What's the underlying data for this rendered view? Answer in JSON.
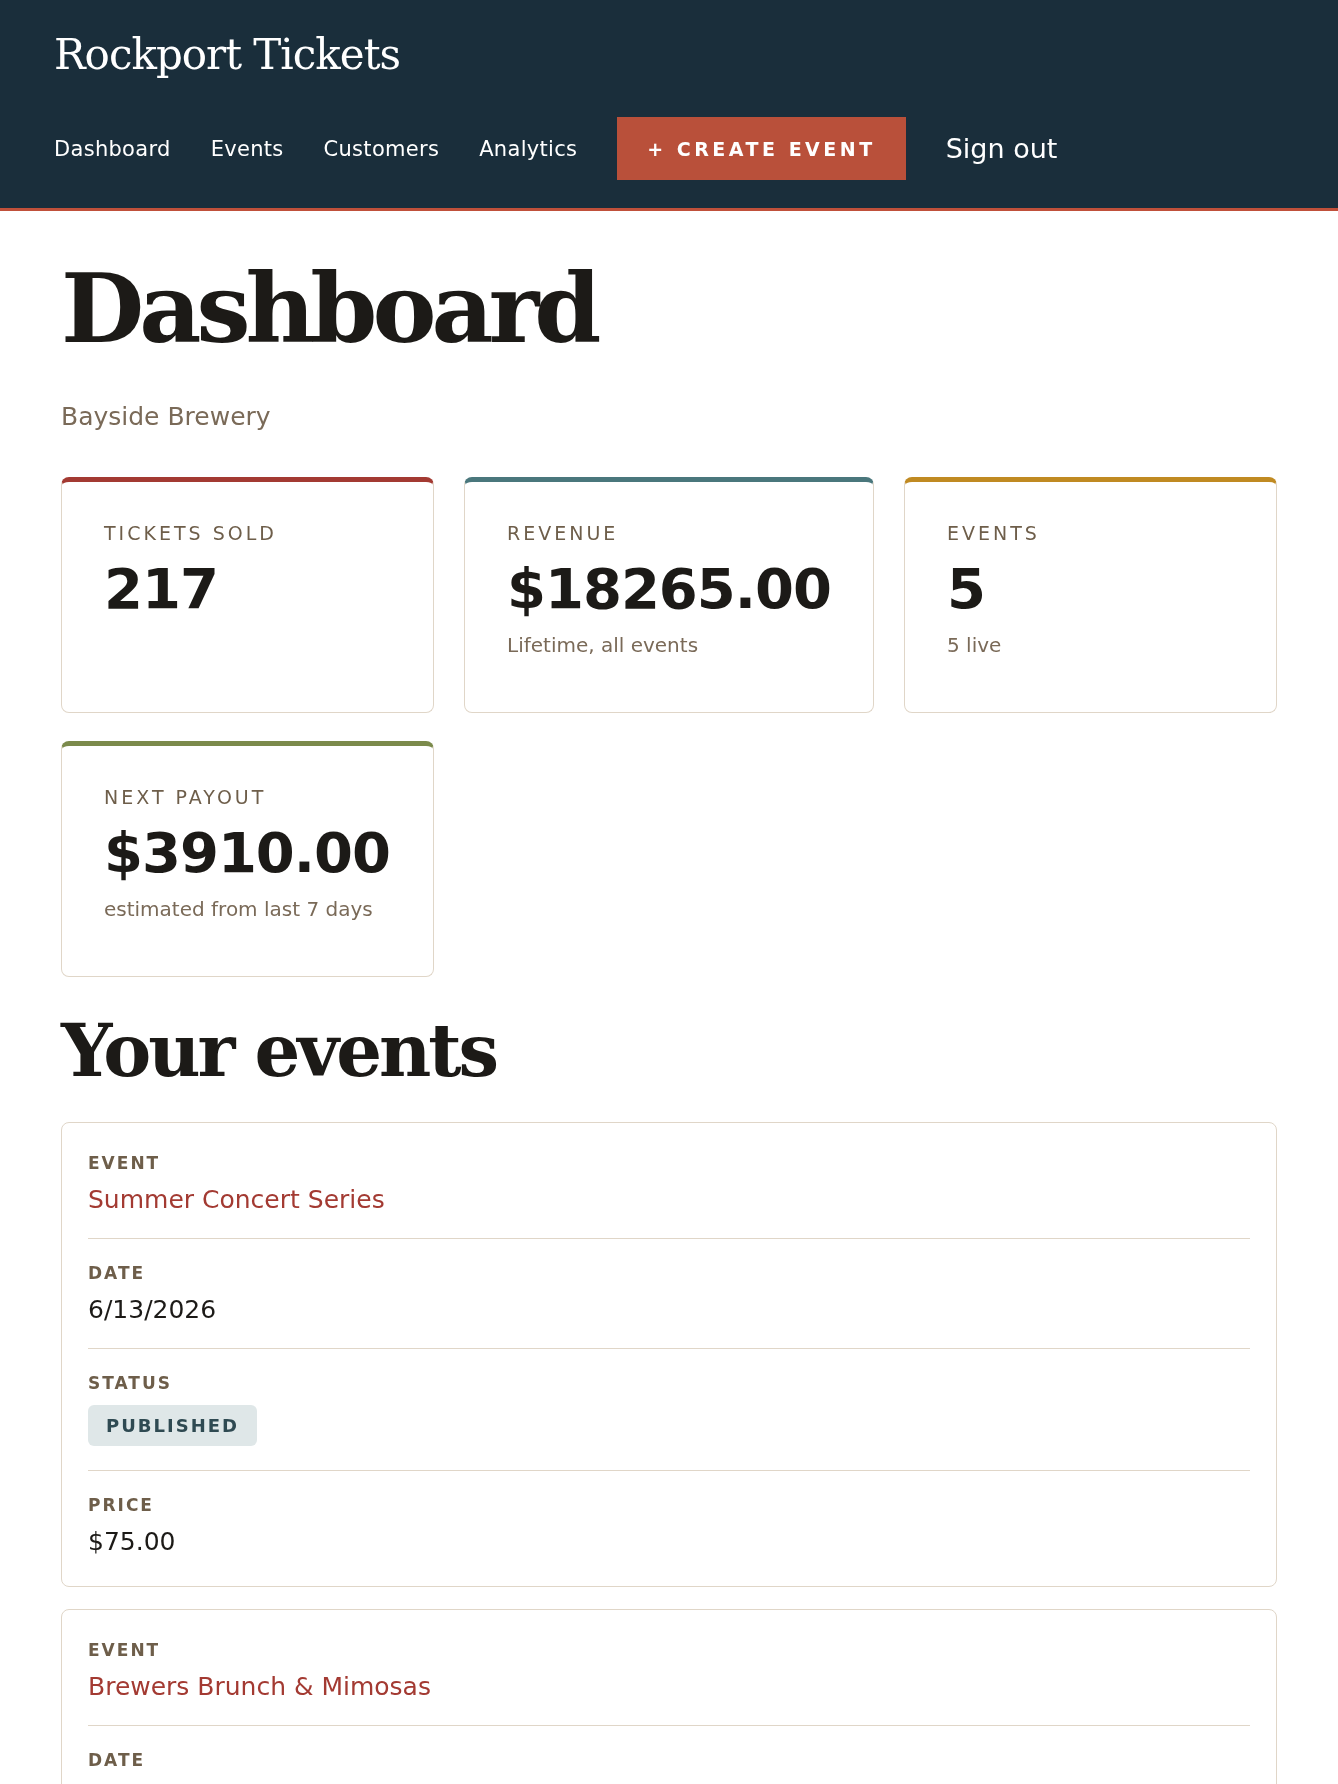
{
  "header": {
    "brand": "Rockport Tickets",
    "nav": [
      {
        "label": "Dashboard",
        "kind": "link"
      },
      {
        "label": "Events",
        "kind": "link"
      },
      {
        "label": "Customers",
        "kind": "link"
      },
      {
        "label": "Analytics",
        "kind": "link"
      },
      {
        "label": "+ CREATE EVENT",
        "kind": "button"
      },
      {
        "label": "Sign out",
        "kind": "plain"
      }
    ]
  },
  "page": {
    "title": "Dashboard",
    "subtitle": "Bayside Brewery"
  },
  "stats": [
    {
      "label": "TICKETS SOLD",
      "value": "217",
      "color": "#a33a32"
    },
    {
      "label": "REVENUE",
      "value": "$18265.00",
      "note": "Lifetime, all events",
      "color": "#4a777c"
    },
    {
      "label": "EVENTS",
      "value": "5",
      "note": "5 live",
      "color": "#c08a22"
    },
    {
      "label": "NEXT PAYOUT",
      "value": "$3910.00",
      "note": "estimated from last 7 days",
      "color": "#7b8a4b"
    }
  ],
  "events_title": "Your events",
  "events": [
    {
      "fields": [
        {
          "label": "EVENT",
          "value": "Summer Concert Series",
          "kind": "link"
        },
        {
          "label": "DATE",
          "value": "6/13/2026",
          "kind": "text"
        },
        {
          "label": "STATUS",
          "value": "PUBLISHED",
          "kind": "badge"
        },
        {
          "label": "PRICE",
          "value": "$75.00",
          "kind": "text"
        }
      ]
    },
    {
      "fields": [
        {
          "label": "EVENT",
          "value": "Brewers Brunch & Mimosas",
          "kind": "link"
        },
        {
          "label": "DATE"
        }
      ]
    }
  ]
}
